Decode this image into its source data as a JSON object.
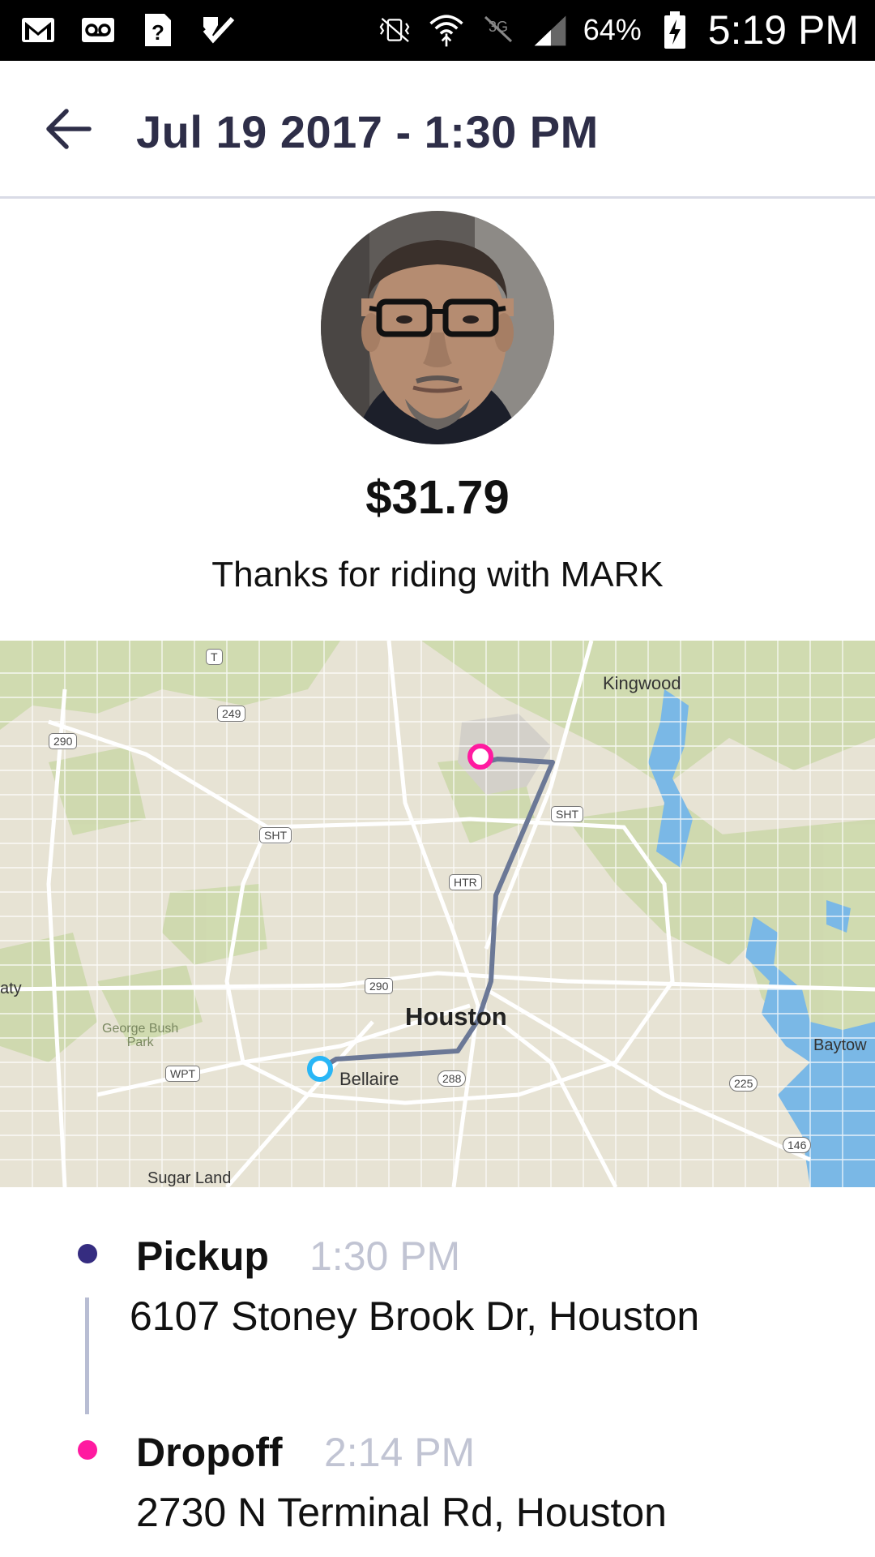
{
  "status_bar": {
    "left_icons": [
      "gmail-icon",
      "voicemail-icon",
      "unknown-app-icon",
      "task-check-icon"
    ],
    "right_icons": [
      "vibrate-icon",
      "wifi-icon",
      "no-data-icon",
      "signal-icon",
      "battery-charging-icon"
    ],
    "battery_percent": "64%",
    "time": "5:19 PM"
  },
  "header": {
    "back_icon": "arrow-left-icon",
    "title": "Jul 19 2017 - 1:30 PM"
  },
  "ride": {
    "fare": "$31.79",
    "thanks_message": "Thanks for riding with MARK"
  },
  "map": {
    "labels": {
      "kingwood": "Kingwood",
      "houston": "Houston",
      "bellaire": "Bellaire",
      "george_bush_park": "George Bush\nPark",
      "sugar_land": "Sugar Land",
      "baytown": "Baytow",
      "katy": "aty"
    },
    "shields": {
      "r249": "249",
      "r290a": "290",
      "r290b": "290",
      "sht_west": "SHT",
      "sht_east": "SHT",
      "htr": "HTR",
      "wpt": "WPT",
      "r288": "288",
      "r225": "225",
      "r146": "146",
      "t": "T"
    },
    "colors": {
      "pickup_marker": "#29b6f6",
      "dropoff_marker": "#ff1aa0",
      "route": "#6b7896"
    }
  },
  "trip": {
    "pickup": {
      "label": "Pickup",
      "time": "1:30 PM",
      "address": "6107 Stoney Brook Dr, Houston",
      "dot_color": "#352c80"
    },
    "dropoff": {
      "label": "Dropoff",
      "time": "2:14 PM",
      "address": "2730 N Terminal Rd, Houston",
      "dot_color": "#ff1aa0"
    }
  }
}
